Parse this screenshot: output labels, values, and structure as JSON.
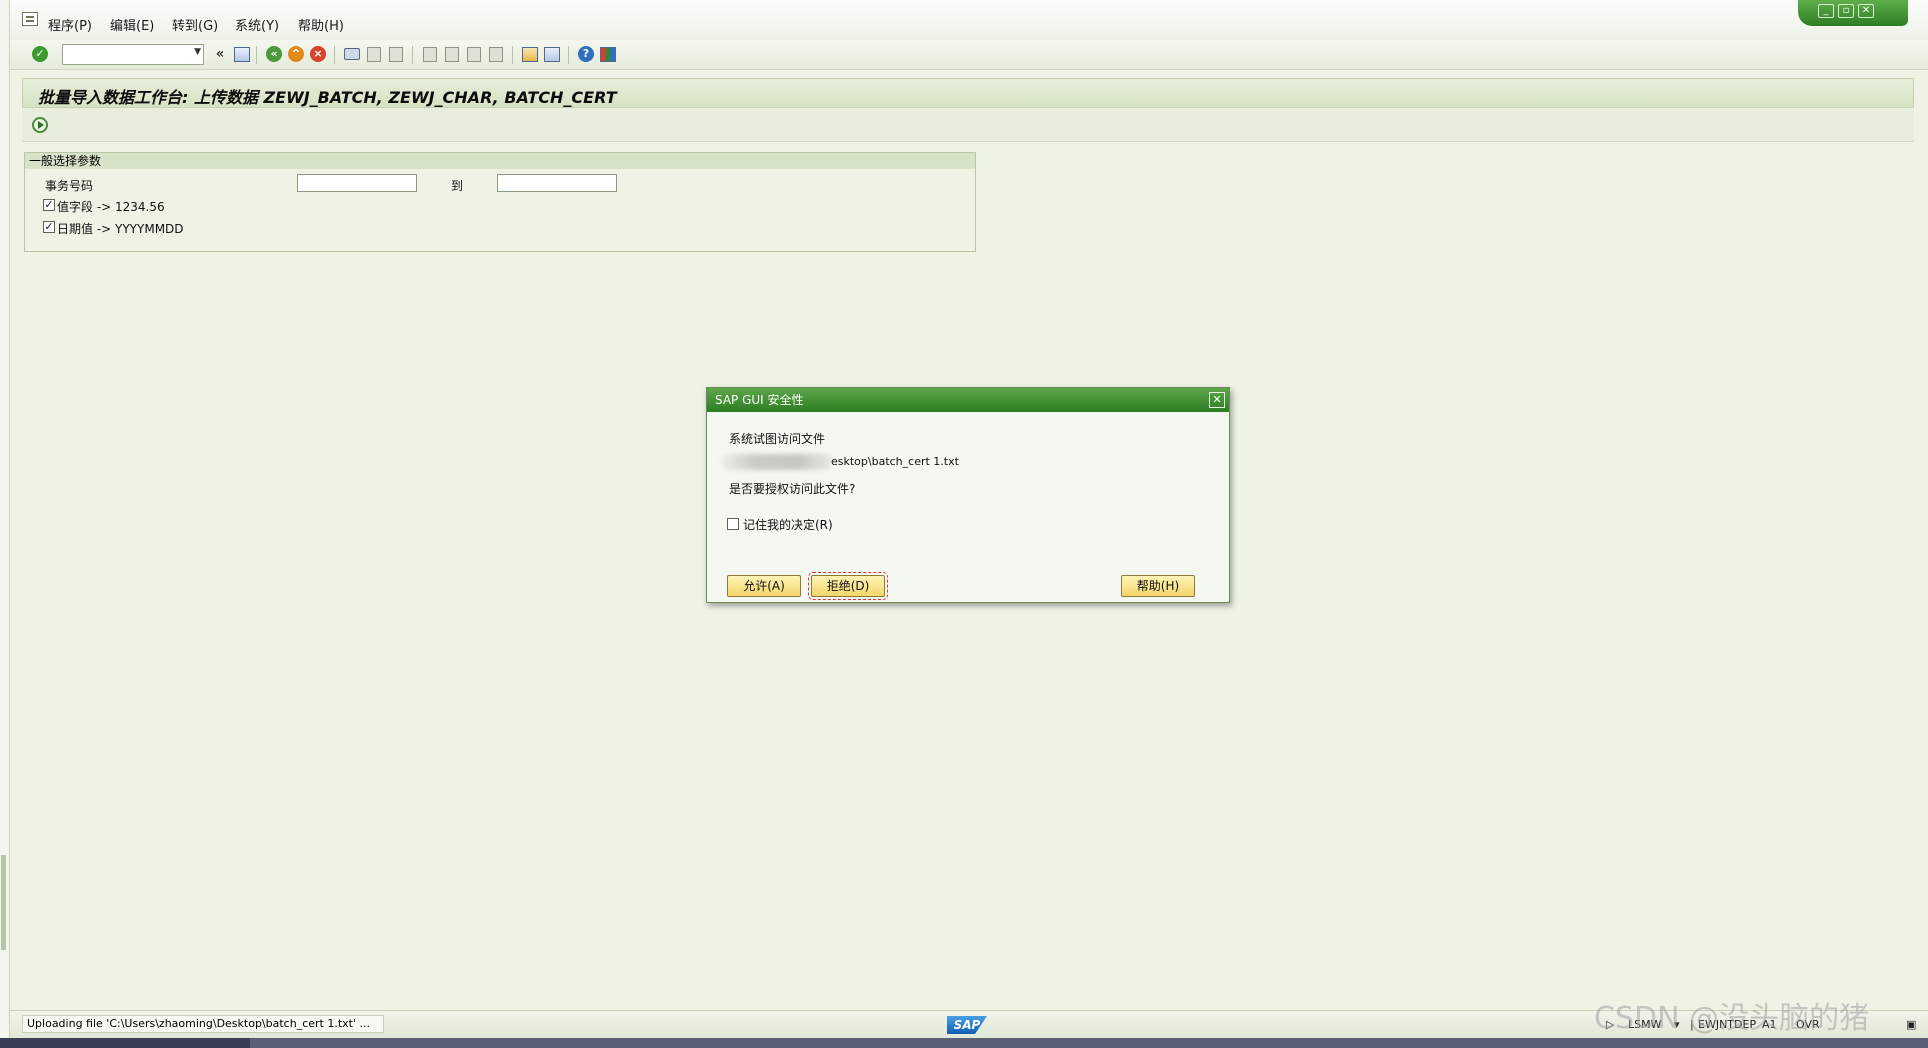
{
  "menu": {
    "items": [
      "程序(P)",
      "编辑(E)",
      "转到(G)",
      "系统(Y)",
      "帮助(H)"
    ]
  },
  "window_controls": [
    "minimize-icon",
    "restore-icon",
    "close-icon"
  ],
  "toolbar": {
    "command_field_value": "",
    "icons": [
      "enter-icon",
      "command-field",
      "back-double-chevron-icon",
      "save-icon",
      "back-icon",
      "exit-icon",
      "cancel-icon",
      "print-icon",
      "find-icon",
      "find-next-icon",
      "first-page-icon",
      "previous-page-icon",
      "next-page-icon",
      "last-page-icon",
      "create-session-icon",
      "shortcut-icon",
      "help-icon",
      "customize-layout-icon"
    ],
    "back_chevrons": "«"
  },
  "page": {
    "title": "批量导入数据工作台: 上传数据 ZEWJ_BATCH, ZEWJ_CHAR, BATCH_CERT"
  },
  "selection": {
    "group_title": "一般选择参数",
    "txn_label": "事务号码",
    "txn_from": "",
    "to_label": "到",
    "txn_to": "",
    "value_field_label": "值字段 -> 1234.56",
    "value_field_checked": true,
    "date_label": "日期值 -> YYYYMMDD",
    "date_checked": true
  },
  "dialog": {
    "title": "SAP GUI 安全性",
    "line1": "系统试图访问文件",
    "path_visible": "esktop\\batch_cert 1.txt",
    "question": "是否要授权访问此文件?",
    "remember_label": "记住我的决定(R)",
    "remember_checked": false,
    "allow_label": "允许(A)",
    "deny_label": "拒绝(D)",
    "help_label": "帮助(H)"
  },
  "status": {
    "message": "Uploading file 'C:\\Users\\zhaoming\\Desktop\\batch_cert 1.txt' ...",
    "transaction": "LSMW",
    "server": "EWJNTDEP",
    "client": "A1",
    "mode": "OVR"
  },
  "watermark": "CSDN @没头脑的猪",
  "colors": {
    "sap_green": "#2c7c22",
    "background": "#eef3e6",
    "button_yellow": "#f4d76a"
  }
}
